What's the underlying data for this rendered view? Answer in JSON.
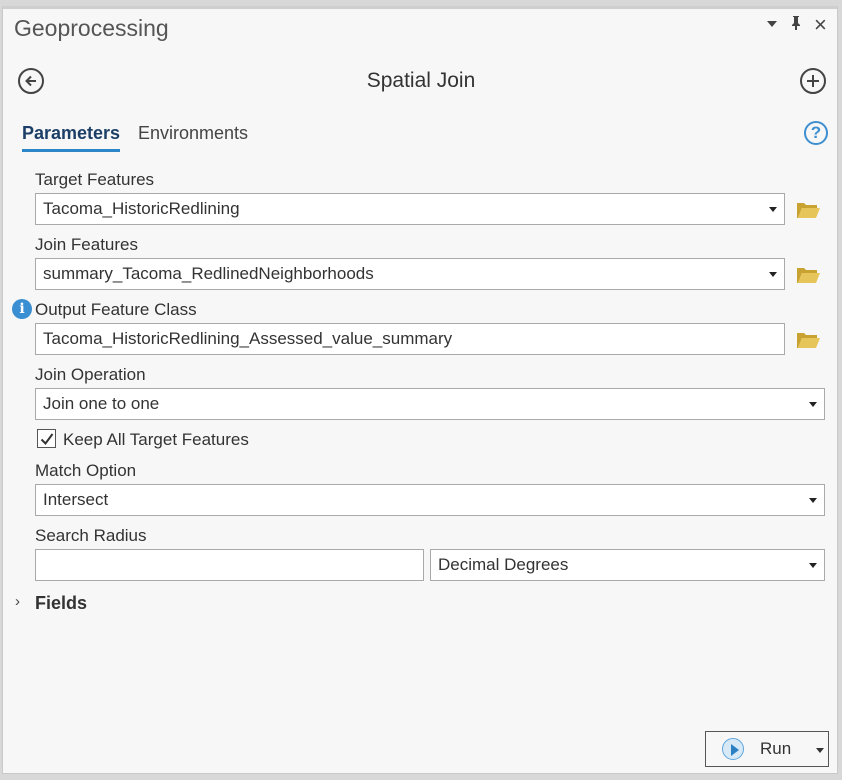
{
  "pane": {
    "title": "Geoprocessing"
  },
  "tool": {
    "title": "Spatial Join"
  },
  "tabs": [
    {
      "label": "Parameters",
      "active": true
    },
    {
      "label": "Environments",
      "active": false
    }
  ],
  "params": {
    "target_features": {
      "label": "Target Features",
      "value": "Tacoma_HistoricRedlining"
    },
    "join_features": {
      "label": "Join Features",
      "value": "summary_Tacoma_RedlinedNeighborhoods"
    },
    "output_feature_class": {
      "label": "Output Feature Class",
      "value": "Tacoma_HistoricRedlining_Assessed_value_summary"
    },
    "join_operation": {
      "label": "Join Operation",
      "value": "Join one to one"
    },
    "keep_all": {
      "label": "Keep All Target Features",
      "checked": true
    },
    "match_option": {
      "label": "Match Option",
      "value": "Intersect"
    },
    "search_radius": {
      "label": "Search Radius",
      "value": "",
      "unit": "Decimal Degrees"
    }
  },
  "fields_section": {
    "label": "Fields"
  },
  "run_button": {
    "label": "Run"
  },
  "colors": {
    "accent": "#2b85c6",
    "folder": "#d8b64a",
    "info": "#3a8ed2"
  },
  "icons": [
    "back-icon",
    "add-icon",
    "help-icon",
    "folder-icon",
    "info-icon",
    "pin-icon",
    "close-icon",
    "run-icon"
  ]
}
